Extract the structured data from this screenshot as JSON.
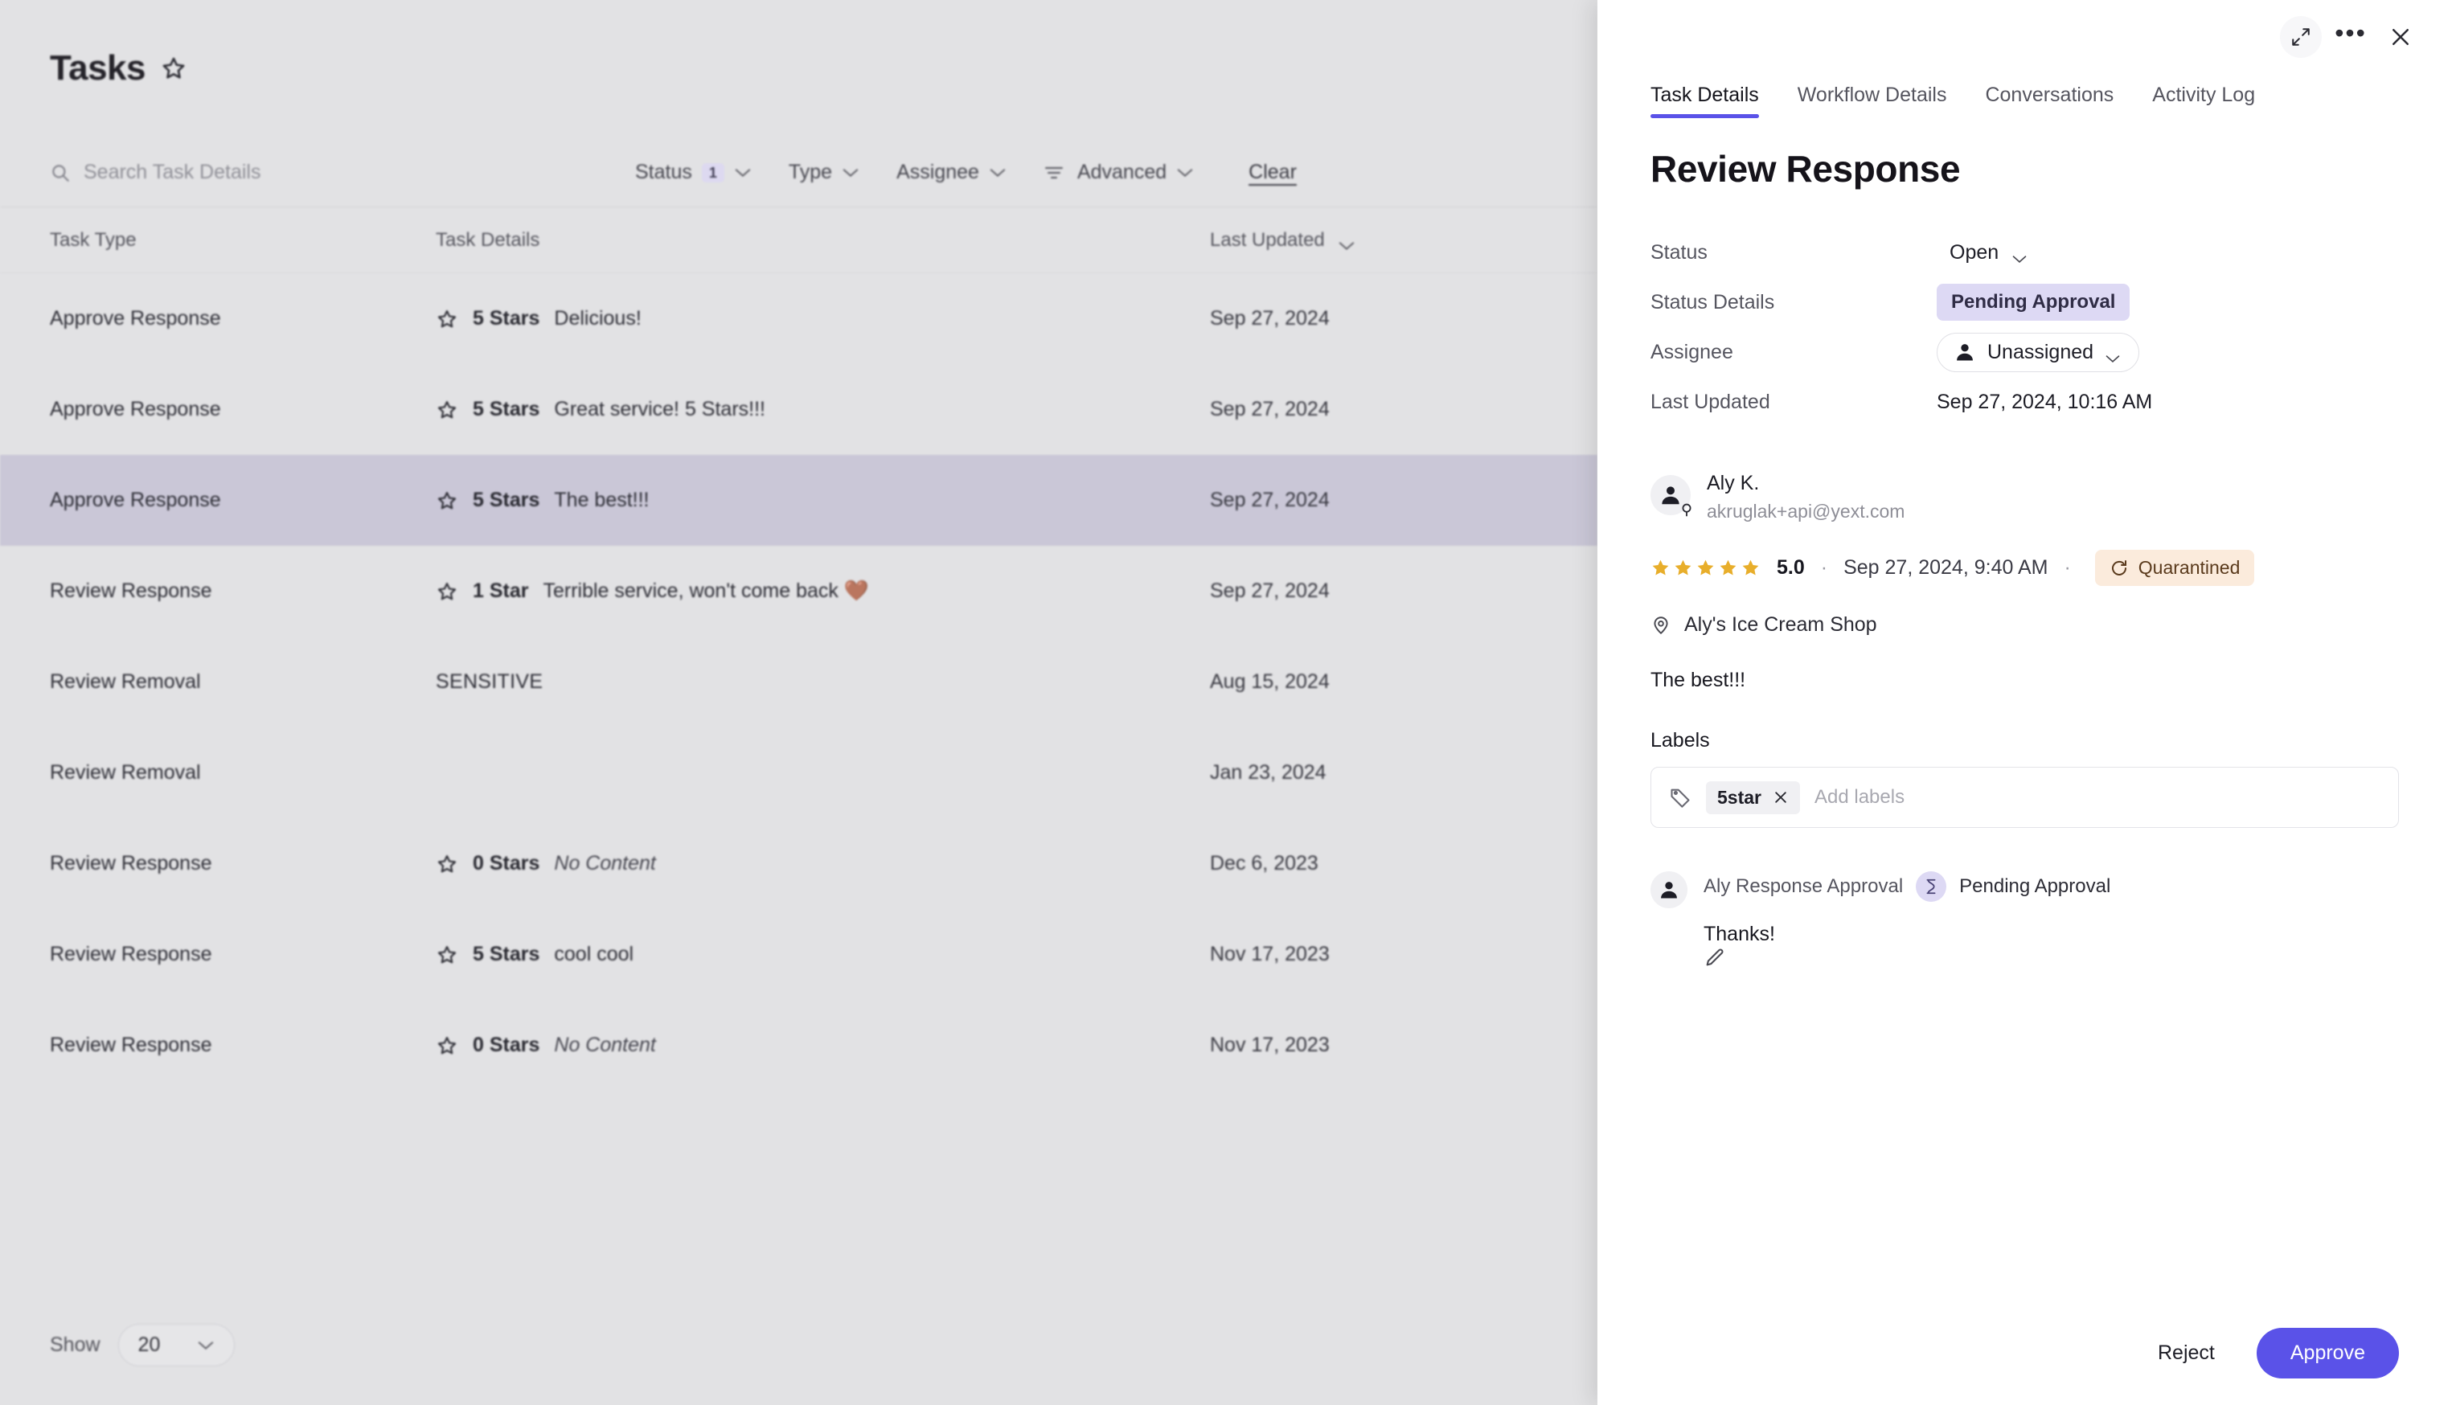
{
  "left": {
    "page_title": "Tasks",
    "favorite_icon": "star-outline-icon",
    "search": {
      "placeholder": "Search Task Details",
      "value": "",
      "icon": "search-icon"
    },
    "filters": [
      {
        "label": "Status",
        "count": "1",
        "icon": "chevron-down-icon"
      },
      {
        "label": "Type",
        "count": "",
        "icon": "chevron-down-icon"
      },
      {
        "label": "Assignee",
        "count": "",
        "icon": "chevron-down-icon"
      },
      {
        "label": "Advanced",
        "count": "",
        "icon": "filter-lines-icon"
      }
    ],
    "clear_label": "Clear",
    "table": {
      "columns": [
        "Task Type",
        "Task Details",
        "Last Updated"
      ],
      "sort_icon": "chevron-down-icon",
      "rows": [
        {
          "type": "Approve Response",
          "stars": "5 Stars",
          "snippet": "Delicious!",
          "muted": false,
          "date": "Sep 27, 2024",
          "selected": false
        },
        {
          "type": "Approve Response",
          "stars": "5 Stars",
          "snippet": "Great service! 5 Stars!!!",
          "muted": false,
          "date": "Sep 27, 2024",
          "selected": false
        },
        {
          "type": "Approve Response",
          "stars": "5 Stars",
          "snippet": "The best!!!",
          "muted": false,
          "date": "Sep 27, 2024",
          "selected": true
        },
        {
          "type": "Review Response",
          "stars": "1 Star",
          "snippet": "Terrible service, won't come back 🤎",
          "muted": false,
          "date": "Sep 27, 2024",
          "selected": false
        },
        {
          "type": "Review Removal",
          "stars": "",
          "snippet": "SENSITIVE",
          "muted": false,
          "date": "Aug 15, 2024",
          "selected": false
        },
        {
          "type": "Review Removal",
          "stars": "",
          "snippet": "",
          "muted": false,
          "date": "Jan 23, 2024",
          "selected": false
        },
        {
          "type": "Review Response",
          "stars": "0 Stars",
          "snippet": "No Content",
          "muted": true,
          "date": "Dec 6, 2023",
          "selected": false
        },
        {
          "type": "Review Response",
          "stars": "5 Stars",
          "snippet": "cool cool",
          "muted": false,
          "date": "Nov 17, 2023",
          "selected": false
        },
        {
          "type": "Review Response",
          "stars": "0 Stars",
          "snippet": "No Content",
          "muted": true,
          "date": "Nov 17, 2023",
          "selected": false
        }
      ]
    },
    "pagination": {
      "show_label": "Show",
      "page_size": "20",
      "icon": "chevron-down-icon"
    }
  },
  "panel": {
    "topbar_icons": [
      "expand-icon",
      "more-options-icon",
      "close-icon"
    ],
    "tabs": [
      {
        "label": "Task Details",
        "active": true
      },
      {
        "label": "Workflow Details",
        "active": false
      },
      {
        "label": "Conversations",
        "active": false
      },
      {
        "label": "Activity Log",
        "active": false
      }
    ],
    "title": "Review Response",
    "meta": {
      "status_key": "Status",
      "status_value": "Open",
      "status_details_key": "Status Details",
      "status_details_value": "Pending Approval",
      "assignee_key": "Assignee",
      "assignee_value": "Unassigned",
      "last_updated_key": "Last Updated",
      "last_updated_value": "Sep 27, 2024, 10:16 AM"
    },
    "review": {
      "reviewer_name": "Aly K.",
      "reviewer_email": "akruglak+api@yext.com",
      "rating_stars": 5,
      "rating_value": "5.0",
      "rating_date": "Sep 27, 2024, 9:40 AM",
      "status_badge": "Quarantined",
      "location": "Aly's Ice Cream Shop",
      "body": "The best!!!"
    },
    "labels": {
      "title": "Labels",
      "chips": [
        {
          "text": "5star"
        }
      ],
      "placeholder": "Add labels"
    },
    "response": {
      "author": "Aly Response Approval",
      "status": "Pending Approval",
      "text": "Thanks!",
      "edit_icon": "pencil-icon"
    },
    "footer": {
      "reject_label": "Reject",
      "approve_label": "Approve"
    }
  },
  "colors": {
    "accent": "#5a52e8",
    "selected_row": "#c8c5d6",
    "badge_pending_bg": "#ddd9f4",
    "badge_quarantined_bg": "#fbebdc",
    "star_gold": "#e8ae2b"
  }
}
